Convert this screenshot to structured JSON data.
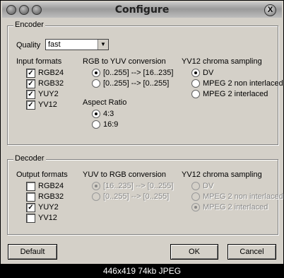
{
  "window": {
    "title": "Configure",
    "close_glyph": "X"
  },
  "encoder": {
    "group_label": "Encoder",
    "quality_label": "Quality",
    "quality_value": "fast",
    "input_formats_label": "Input formats",
    "input_formats": [
      {
        "label": "RGB24",
        "checked": true
      },
      {
        "label": "RGB32",
        "checked": true
      },
      {
        "label": "YUY2",
        "checked": true
      },
      {
        "label": "YV12",
        "checked": true
      }
    ],
    "conversion_label": "RGB to YUV conversion",
    "conversion_options": [
      "[0..255] --> [16..235]",
      "[0..255] --> [0..255]"
    ],
    "aspect_label": "Aspect Ratio",
    "aspect_options": [
      "4:3",
      "16:9"
    ],
    "chroma_label": "YV12 chroma sampling",
    "chroma_options": [
      "DV",
      "MPEG 2 non interlaced",
      "MPEG 2 interlaced"
    ]
  },
  "decoder": {
    "group_label": "Decoder",
    "output_formats_label": "Output formats",
    "output_formats": [
      {
        "label": "RGB24",
        "checked": false
      },
      {
        "label": "RGB32",
        "checked": false
      },
      {
        "label": "YUY2",
        "checked": true
      },
      {
        "label": "YV12",
        "checked": false
      }
    ],
    "conversion_label": "YUV to RGB conversion",
    "conversion_options": [
      "[16..235] --> [0..255]",
      "[0..255] --> [0..255]"
    ],
    "chroma_label": "YV12 chroma sampling",
    "chroma_options": [
      "DV",
      "MPEG 2 non interlaced",
      "MPEG 2 interlaced"
    ]
  },
  "buttons": {
    "default": "Default",
    "ok": "OK",
    "cancel": "Cancel"
  },
  "caption": "446x419 74kb JPEG"
}
